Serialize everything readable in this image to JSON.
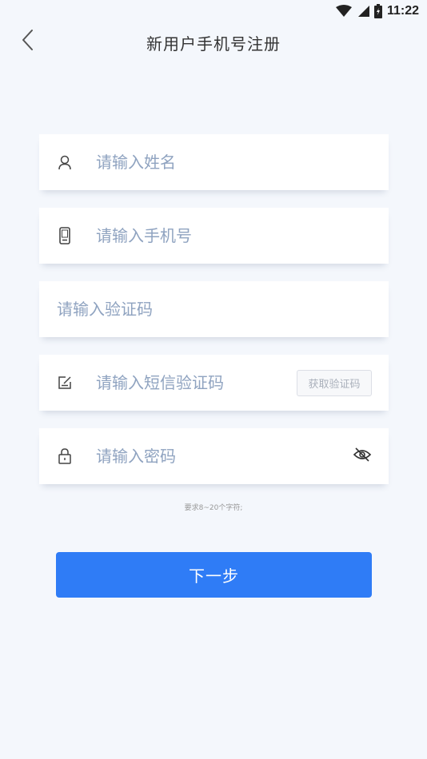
{
  "status_bar": {
    "time": "11:22",
    "icons": [
      "wifi-icon",
      "signal-icon",
      "battery-icon"
    ]
  },
  "header": {
    "title": "新用户手机号注册",
    "back_icon": "chevron-left-icon"
  },
  "form": {
    "name": {
      "placeholder": "请输入姓名",
      "value": "",
      "icon": "user-icon"
    },
    "phone": {
      "placeholder": "请输入手机号",
      "value": "",
      "icon": "mobile-phone-icon"
    },
    "captcha": {
      "placeholder": "请输入验证码",
      "value": ""
    },
    "sms": {
      "placeholder": "请输入短信验证码",
      "value": "",
      "icon": "edit-icon",
      "button_label": "获取验证码"
    },
    "password": {
      "placeholder": "请输入密码",
      "value": "",
      "icon": "lock-icon",
      "toggle_icon": "eye-off-icon"
    },
    "password_hint": "要求8~20个字符;"
  },
  "actions": {
    "next_label": "下一步"
  },
  "colors": {
    "background": "#f4f7fc",
    "primary": "#2f7cf6",
    "placeholder": "#8fa3c0"
  }
}
